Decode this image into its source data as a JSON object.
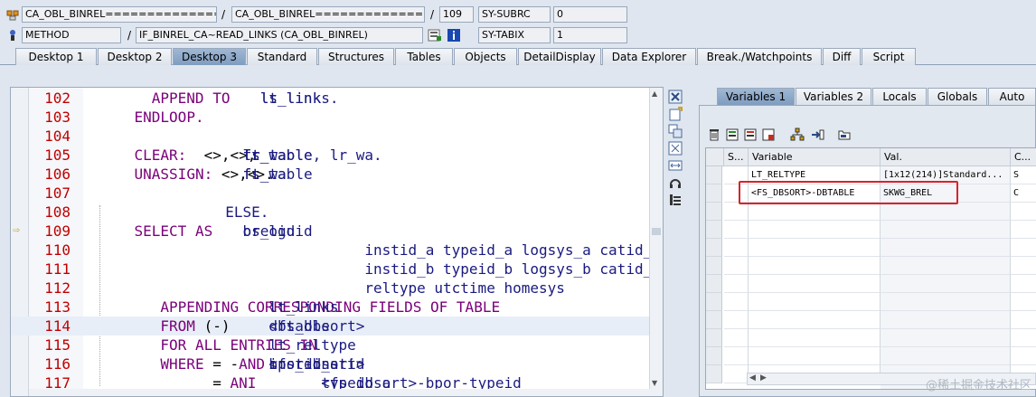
{
  "header": {
    "row1": {
      "field1": "CA_OBL_BINREL=================",
      "sep1": "/",
      "field2": "CA_OBL_BINREL=================",
      "sep2": "/",
      "line_no": "109",
      "sysfield": "SY-SUBRC",
      "sysvalue": "0"
    },
    "row2": {
      "type": "METHOD",
      "sep1": "/",
      "method": "IF_BINREL_CA~READ_LINKS (CA_OBL_BINREL)",
      "sysfield": "SY-TABIX",
      "sysvalue": "1"
    }
  },
  "tabs": [
    "Desktop 1",
    "Desktop 2",
    "Desktop 3",
    "Standard",
    "Structures",
    "Tables",
    "Objects",
    "DetailDisplay",
    "Data Explorer",
    "Break./Watchpoints",
    "Diff",
    "Script"
  ],
  "active_tab": "Desktop 3",
  "code": [
    {
      "ln": "102",
      "parts": [
        [
          "kw",
          "APPEND "
        ],
        [
          "tx",
          "ls_link "
        ],
        [
          "kw",
          "TO "
        ],
        [
          "tx",
          "lt_links."
        ]
      ],
      "indent": 3
    },
    {
      "ln": "103",
      "parts": [
        [
          "kw",
          "ENDLOOP."
        ]
      ],
      "indent": 2
    },
    {
      "ln": "104",
      "parts": [],
      "indent": 0
    },
    {
      "ln": "105",
      "parts": [
        [
          "kw",
          "CLEAR:  "
        ],
        [
          "op",
          "<"
        ],
        [
          "tx",
          "fs_wa"
        ],
        [
          "op",
          ">,<"
        ],
        [
          "tx",
          "ft_table"
        ],
        [
          "op",
          ">,"
        ],
        [
          "tx",
          "lr_table, lr_wa."
        ]
      ],
      "indent": 2
    },
    {
      "ln": "106",
      "parts": [
        [
          "kw",
          "UNASSIGN: "
        ],
        [
          "op",
          "<"
        ],
        [
          "tx",
          "ft_table"
        ],
        [
          "op",
          ">,<"
        ],
        [
          "tx",
          "fs_wa"
        ],
        [
          "op",
          ">."
        ]
      ],
      "indent": 2
    },
    {
      "ln": "107",
      "parts": [],
      "indent": 0
    },
    {
      "ln": "108",
      "parts": [
        [
          "tx",
          "ELSE."
        ]
      ],
      "indent": 1
    },
    {
      "ln": "109",
      "parts": [
        [
          "kw",
          "SELECT "
        ],
        [
          "tx",
          "brelguid "
        ],
        [
          "kw",
          "AS "
        ],
        [
          "tx",
          "os_oid"
        ]
      ],
      "indent": 2
    },
    {
      "ln": "110",
      "parts": [
        [
          "tx",
          "instid_a typeid_a logsys_a catid_a arch_a"
        ]
      ],
      "indent": 9
    },
    {
      "ln": "111",
      "parts": [
        [
          "tx",
          "instid_b typeid_b logsys_b catid_b arch_b"
        ]
      ],
      "indent": 9
    },
    {
      "ln": "112",
      "parts": [
        [
          "tx",
          "reltype utctime homesys"
        ]
      ],
      "indent": 9
    },
    {
      "ln": "113",
      "parts": [
        [
          "kw",
          "APPENDING CORRESPONDING FIELDS OF TABLE "
        ],
        [
          "tx",
          "lt_links"
        ]
      ],
      "indent": 3.5
    },
    {
      "ln": "114",
      "parts": [
        [
          "kw",
          "FROM "
        ],
        [
          "op",
          "("
        ],
        [
          "tx",
          "<fs_dbsort>"
        ],
        [
          "op",
          "-"
        ],
        [
          "tx",
          "dbtable"
        ],
        [
          "op",
          ")"
        ]
      ],
      "indent": 3.5
    },
    {
      "ln": "115",
      "parts": [
        [
          "kw",
          "FOR ALL ENTRIES IN "
        ],
        [
          "tx",
          "lt_reltype"
        ]
      ],
      "indent": 3.5
    },
    {
      "ln": "116",
      "parts": [
        [
          "kw",
          "WHERE "
        ],
        [
          "tx",
          "instid_a  "
        ],
        [
          "op",
          "= "
        ],
        [
          "tx",
          "<fs_dbsort>"
        ],
        [
          "op",
          "-"
        ],
        [
          "tx",
          "bpor-instid "
        ],
        [
          "kw",
          "AND"
        ]
      ],
      "indent": 3.5
    },
    {
      "ln": "117",
      "parts": [
        [
          "tx",
          "typeid_a      "
        ],
        [
          "op",
          "= "
        ],
        [
          "tx",
          "<fs_dbsort>-bpor-typeid "
        ],
        [
          "kw",
          "ANI"
        ]
      ],
      "indent": 6.5
    }
  ],
  "current_line": "114",
  "exec_line": "109",
  "var_tabs": [
    "Variables 1",
    "Variables 2",
    "Locals",
    "Globals",
    "Auto"
  ],
  "active_var_tab": "Variables 1",
  "grid": {
    "headers": [
      "S...",
      "Variable",
      "Val.",
      "C..."
    ],
    "rows": [
      {
        "variable": "LT_RELTYPE",
        "value": "[1x12(214)]Standard...",
        "extra": "S"
      },
      {
        "variable": "<FS_DBSORT>-DBTABLE",
        "value": "SKWG_BREL",
        "extra": "C"
      }
    ]
  },
  "watermark": "@稀土掘金技术社区",
  "colors": {
    "keyword": "#7a007a",
    "identifier": "#1a1a80",
    "line_number": "#c00000",
    "highlight_box": "#d8232a",
    "active_tab": "#8aa6c8"
  }
}
